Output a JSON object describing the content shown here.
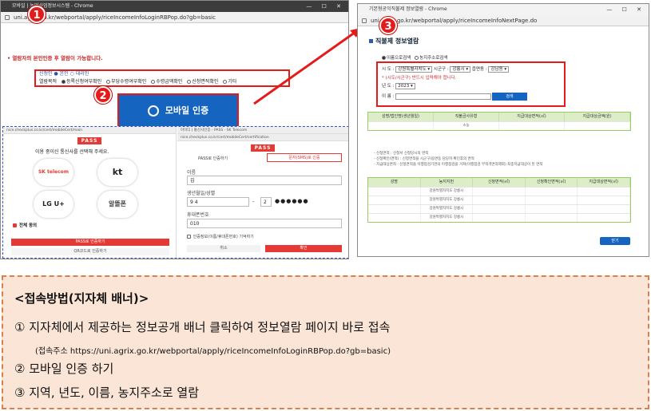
{
  "window1": {
    "title": "모바일 | 농업사업정보시스템 - Chrome",
    "url": "uni.agrix.go.kr/webportal/apply/riceIncomeInfoLoginRBPop.do?gb=basic",
    "notice": "• 열람자의 본인인증 후 열람이 가능합니다.",
    "purpose_top": "신청인 ● 본인 ○ 대리인",
    "purpose_label": "열람목적",
    "purpose_options": [
      "등록신청여부확인",
      "부당수령여부확인",
      "수령금액확인",
      "신청면적확인",
      "기타"
    ],
    "auth_button": "모바일 인증",
    "marker1": "1",
    "marker2": "2"
  },
  "pass": {
    "url_left": "nice.checkplus.co.kr/cert/mobileCert/main",
    "url_mid": "nice.checkplus.co.kr/cert/mobileCert/certification",
    "window_title_right": "아이디 | 통신사인증 - PASS - SK Telecom",
    "logo": "PASS",
    "choose_carrier": "이용 중이신 통신사를 선택해 주세요.",
    "carriers": [
      "SK telecom",
      "kt",
      "LG U+",
      "알뜰폰"
    ],
    "agree_all": "전체 동의",
    "start_button": "PASS로 인증하기",
    "qr_button": "QR코드로 인증하기",
    "tab_pass": "PASS로 인증하기",
    "tab_sms": "문자(SMS)로 인증",
    "name_label": "이름",
    "name_value": "김",
    "birth_label": "생년월일/성별",
    "birth_value": "9 4",
    "gender_value": "2",
    "phone_label": "휴대폰번호",
    "phone_value": "010",
    "remember": "인증정보(이름/휴대폰번호) 기억하기",
    "cancel": "취소",
    "confirm": "확인"
  },
  "window2": {
    "title": "기본형공익직불제 정보열람 - Chrome",
    "url": "uni.agrix.go.kr/webportal/apply/riceIncomeInfoNextPage.do",
    "page_title": "직불제 정보열람",
    "marker3": "3",
    "radio_options": [
      "이름으로검색",
      "농지주소로검색"
    ],
    "sido_label": "시    도 :",
    "sido_value": "강원특별자치도",
    "sigungu_label": "시군구 :",
    "sigungu_value": "강릉시",
    "eupmyeon_label": "읍면동 :",
    "eupmyeon_value": "강남동",
    "warning": "* (시도/시군구) 반드시 입력해야 합니다.",
    "year_label": "년    도 :",
    "year_value": "2023",
    "name_label": "이    름 :",
    "search_button": "검색",
    "table1_headers": [
      "성명/법인명(생년월일)",
      "직불금사유형",
      "지급대상면적(㎡)",
      "지급대상금액(원)"
    ],
    "table1_row": [
      "",
      "소농",
      "",
      ""
    ],
    "notes": [
      "- 신청면적    : 신청서 신청당시의 면적",
      "- 신청확인(면적)    : 신청면적을 시군구/읍면동 담당자 확인후의 면적",
      "- 지급대상면적 : 신청면적을 이행점검기관의 이행점검을 거쳐(이행점검 부적격면적제외) 최종지급대상이 된 면적"
    ],
    "table2_headers": [
      "성명",
      "농지지번",
      "신청면적(㎡)",
      "신청확인면적(㎡)",
      "지급대상면적(㎡)"
    ],
    "table2_rows": [
      [
        "",
        "강원특별자치도 강릉시",
        "",
        "",
        ""
      ],
      [
        "",
        "강원특별자치도 강릉시",
        "",
        "",
        ""
      ],
      [
        "",
        "강원특별자치도 강릉시",
        "",
        "",
        ""
      ],
      [
        "",
        "강원특별자치도 강릉시",
        "",
        "",
        ""
      ]
    ],
    "confirm_button": "닫기"
  },
  "guide": {
    "heading": "<접속방법(지자체 배너)>",
    "item1": "① 지자체에서 제공하는 정보공개 배너 클릭하여 정보열람 페이지 바로 접속",
    "item1_sub": "(접속주소 https://uni.agrix.go.kr/webportal/apply/riceIncomeInfoLoginRBPop.do?gb=basic)",
    "item2": "② 모바일 인증 하기",
    "item3": "③ 지역, 년도, 이름, 농지주소로 열람"
  },
  "colors": {
    "accent_red": "#e31b1b",
    "button_blue": "#1565c0",
    "guide_bg": "#fbe5d6",
    "guide_border": "#d9804c"
  }
}
